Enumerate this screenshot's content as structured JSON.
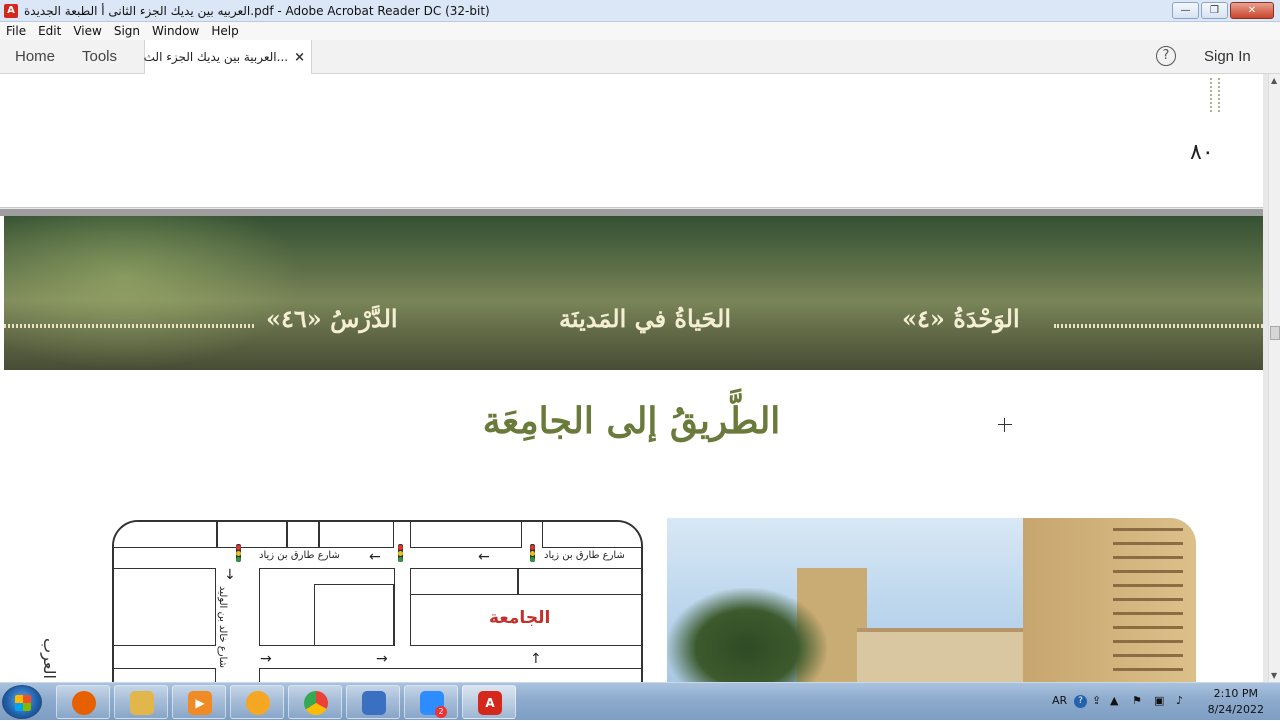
{
  "window": {
    "title": "العربيه بين يديك الجزء الثانى أ الطبعة الجديدة.pdf - Adobe Acrobat Reader DC (32-bit)",
    "min_label": "▭",
    "restore_label": "❐",
    "close_label": "✕"
  },
  "menu": [
    "File",
    "Edit",
    "View",
    "Sign",
    "Window",
    "Help"
  ],
  "toolbar": {
    "home": "Home",
    "tools": "Tools",
    "doc_tab": "العربية بين يديك الجزء الث...",
    "tab_close": "×",
    "help": "?",
    "signin": "Sign In"
  },
  "document": {
    "page_number": "٨٠",
    "unit_label": "الوَحْدَةُ «٤»",
    "life_label": "الحَياةُ في المَدينَة",
    "lesson_label": "الدَّرْسُ «٤٦»",
    "lesson_title": "الطَّريقُ إلى الجامِعَة",
    "side_text": "العرب",
    "map": {
      "street_top_right": "شارع طارق بن زياد",
      "street_top_left": "شارع طارق بن زياد",
      "street_vertical": "شارع خالد بن الوليد",
      "university_label": "الجامعة"
    }
  },
  "taskbar": {
    "apps": [
      {
        "name": "firefox-icon",
        "color": "#e66000"
      },
      {
        "name": "file-explorer-icon",
        "color": "#e1b64a"
      },
      {
        "name": "media-player-icon",
        "color": "#f08a24"
      },
      {
        "name": "vlc-icon",
        "color": "#f5a623"
      },
      {
        "name": "chrome-icon",
        "color": "#34a853"
      },
      {
        "name": "document-icon",
        "color": "#3b6fc2"
      },
      {
        "name": "zoom-icon",
        "color": "#2d8cff"
      },
      {
        "name": "acrobat-icon",
        "color": "#d4281c"
      }
    ],
    "zoom_badge": "2",
    "language": "AR",
    "time": "2:10 PM",
    "date": "8/24/2022"
  }
}
